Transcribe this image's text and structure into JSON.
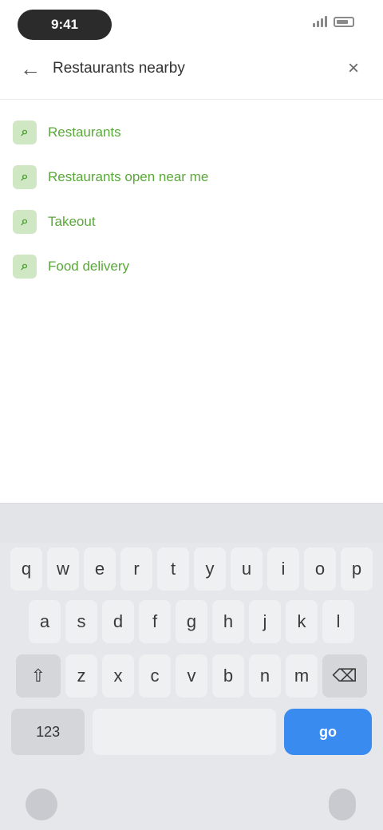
{
  "status_bar": {
    "time": "9:41"
  },
  "search": {
    "query": "Restaurants nearby"
  },
  "suggestions": [
    {
      "label": "Restaurants"
    },
    {
      "label": "Restaurants open near me"
    },
    {
      "label": "Takeout"
    },
    {
      "label": "Food delivery"
    }
  ],
  "keyboard": {
    "row1": [
      "q",
      "w",
      "e",
      "r",
      "t",
      "y",
      "u",
      "i",
      "o",
      "p"
    ],
    "row2": [
      "a",
      "s",
      "d",
      "f",
      "g",
      "h",
      "j",
      "k",
      "l"
    ],
    "row3": [
      "z",
      "x",
      "c",
      "v",
      "b",
      "n",
      "m"
    ],
    "shift_icon": "shift-icon",
    "backspace_icon": "backspace-icon",
    "numbers_label": "123",
    "go_label": "go"
  },
  "colors": {
    "accent_green": "#5aa83a",
    "keyboard_bg": "#e6e7ea",
    "go_blue": "#3a8bf0"
  }
}
